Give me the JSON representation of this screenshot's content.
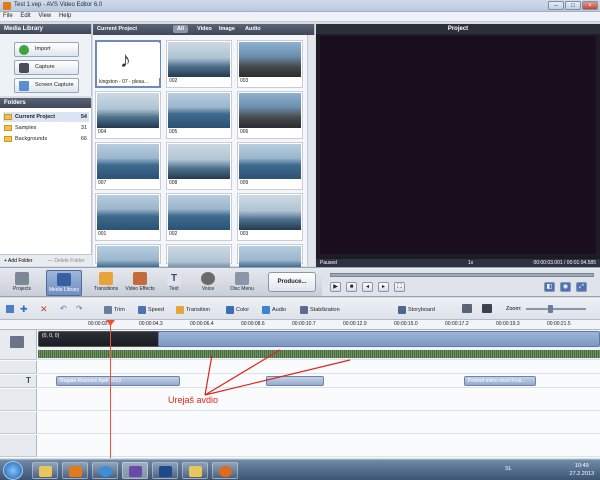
{
  "window": {
    "title": "Test 1.vep - AVS Video Editor 6.0",
    "min": "–",
    "max": "□",
    "close": "×"
  },
  "menu": [
    "File",
    "Edit",
    "View",
    "Help"
  ],
  "media_library": {
    "title": "Media Library",
    "buttons": [
      "Import",
      "Capture",
      "Screen Capture"
    ]
  },
  "folders": {
    "title": "Folders",
    "items": [
      {
        "label": "Current Project",
        "count": "54"
      },
      {
        "label": "Samples",
        "count": "31"
      },
      {
        "label": "Backgrounds",
        "count": "66"
      }
    ],
    "add_folder": "+ Add Folder",
    "delete_folder": "— Delete Folder"
  },
  "project": {
    "title": "Current Project",
    "tabs": [
      "All",
      "Video",
      "Image",
      "Audio"
    ],
    "thumbs": [
      "kingston - 07 - plesa...",
      "002",
      "003",
      "004",
      "005",
      "006",
      "007",
      "008",
      "009",
      "001",
      "002",
      "003",
      "",
      "",
      ""
    ]
  },
  "preview": {
    "title": "Project",
    "status": "Paused",
    "speed": "1x",
    "time": "00:00:03.001 / 00:01:04.585"
  },
  "modes": [
    "Projects",
    "Media Library",
    "Transitions",
    "Video Effects",
    "Text",
    "Voice",
    "Disc Menu"
  ],
  "produce": "Produce...",
  "timeline_tools": {
    "trim": "Trim",
    "speed": "Speed",
    "transition": "Transition",
    "color": "Color",
    "audio": "Audio",
    "stabilization": "Stabilization",
    "storyboard": "Storyboard",
    "zoom": "Zoom:"
  },
  "ruler": [
    "00:00:02.1",
    "00:00:04.3",
    "00:00:06.4",
    "00:00:08.6",
    "00:00:10.7",
    "00:00:12.9",
    "00:00:15.0",
    "00:00:17.2",
    "00:00:19.3",
    "00:00:21.5"
  ],
  "tracks": {
    "video_clip": "(0, 0, 0)",
    "text_clips": [
      "Regata Rozenec  April 2013",
      "Prehod mimo mest Fruš..."
    ]
  },
  "annotation": "Urejaš avdio",
  "taskbar": {
    "lang": "SL",
    "time": "10:49",
    "date": "27.2.2013"
  }
}
